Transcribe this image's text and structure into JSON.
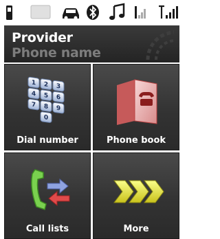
{
  "status_bar": {
    "icons": [
      "phone-icon",
      "battery-icon",
      "car-icon",
      "bluetooth-icon",
      "music-icon",
      "signal-icon",
      "signal-strength-icon"
    ]
  },
  "header": {
    "provider": "Provider",
    "phone_name": "Phone name"
  },
  "tiles": [
    {
      "label": "Dial number",
      "icon": "keypad-icon"
    },
    {
      "label": "Phone book",
      "icon": "phonebook-icon"
    },
    {
      "label": "Call lists",
      "icon": "call-lists-icon"
    },
    {
      "label": "More",
      "icon": "more-icon"
    }
  ],
  "colors": {
    "tile_bg": "#3a3a3a",
    "header_bg": "#2e2e2e",
    "secondary_text": "#7d7d7d"
  }
}
